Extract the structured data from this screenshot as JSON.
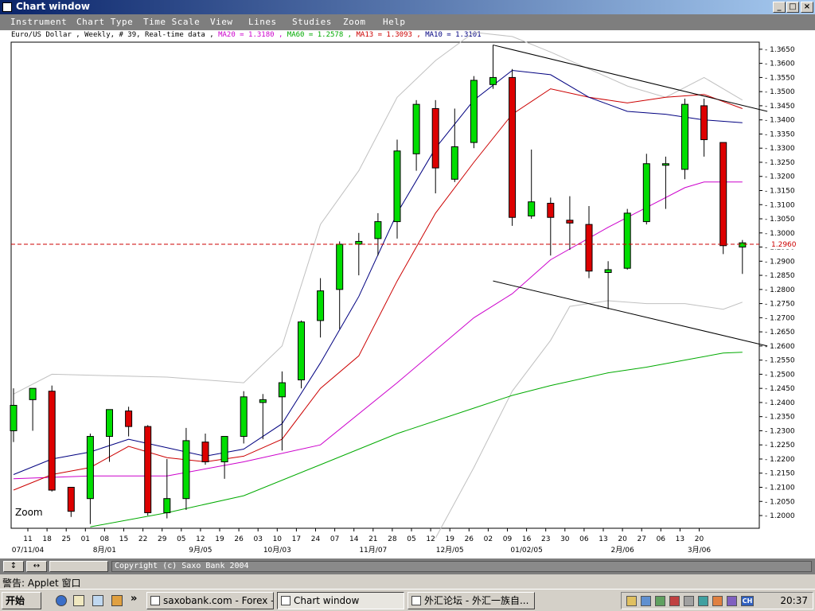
{
  "window": {
    "title": "Chart window",
    "min_label": "_",
    "max_label": "□",
    "close_label": "×"
  },
  "menu": [
    "Instrument",
    "Chart Type",
    "Time Scale",
    "View",
    "Lines",
    "Studies",
    "Zoom",
    "Help"
  ],
  "header": {
    "instrument": "Euro/US Dollar , Weekly, # 39, Real-time data ,",
    "ma20": "MA20 = 1.3180 ,",
    "ma60": "MA60 = 1.2578 ,",
    "ma13": "MA13 = 1.3093 ,",
    "ma10": "MA10 = 1.3101"
  },
  "chart_data": {
    "type": "candlestick",
    "zoom_label": "Zoom",
    "current_price": 1.296,
    "current_price_label": "1.2960",
    "yticks": [
      "1.2000",
      "1.2050",
      "1.2100",
      "1.2150",
      "1.2200",
      "1.2250",
      "1.2300",
      "1.2350",
      "1.2400",
      "1.2450",
      "1.2500",
      "1.2550",
      "1.2600",
      "1.2650",
      "1.2700",
      "1.2750",
      "1.2800",
      "1.2850",
      "1.2900",
      "1.2950",
      "1.3000",
      "1.3050",
      "1.3100",
      "1.3150",
      "1.3200",
      "1.3250",
      "1.3300",
      "1.3350",
      "1.3400",
      "1.3450",
      "1.3500",
      "1.3550",
      "1.3600",
      "1.3650"
    ],
    "xticks": [
      "11",
      "18",
      "25",
      "01",
      "08",
      "15",
      "22",
      "29",
      "05",
      "12",
      "19",
      "26",
      "03",
      "10",
      "17",
      "24",
      "07",
      "14",
      "21",
      "28",
      "05",
      "12",
      "19",
      "26",
      "02",
      "09",
      "16",
      "23",
      "30",
      "06",
      "13",
      "20",
      "27",
      "06",
      "13",
      "20"
    ],
    "month_labels": [
      {
        "label": "07/11/04",
        "week": 0
      },
      {
        "label": "8月/01",
        "week": 4
      },
      {
        "label": "9月/05",
        "week": 9
      },
      {
        "label": "10月/03",
        "week": 13
      },
      {
        "label": "11月/07",
        "week": 18
      },
      {
        "label": "12月/05",
        "week": 22
      },
      {
        "label": "01/02/05",
        "week": 26
      },
      {
        "label": "2月/06",
        "week": 31
      },
      {
        "label": "3月/06",
        "week": 35
      }
    ],
    "candles": [
      {
        "o": 1.23,
        "h": 1.245,
        "l": 1.226,
        "c": 1.239
      },
      {
        "o": 1.241,
        "h": 1.245,
        "l": 1.23,
        "c": 1.245
      },
      {
        "o": 1.244,
        "h": 1.246,
        "l": 1.2085,
        "c": 1.209
      },
      {
        "o": 1.21,
        "h": 1.21,
        "l": 1.1995,
        "c": 1.2015
      },
      {
        "o": 1.206,
        "h": 1.229,
        "l": 1.197,
        "c": 1.228
      },
      {
        "o": 1.228,
        "h": 1.2375,
        "l": 1.219,
        "c": 1.2375
      },
      {
        "o": 1.237,
        "h": 1.2385,
        "l": 1.228,
        "c": 1.2315
      },
      {
        "o": 1.2315,
        "h": 1.232,
        "l": 1.2,
        "c": 1.201
      },
      {
        "o": 1.201,
        "h": 1.22,
        "l": 1.199,
        "c": 1.206
      },
      {
        "o": 1.206,
        "h": 1.231,
        "l": 1.202,
        "c": 1.2265
      },
      {
        "o": 1.226,
        "h": 1.229,
        "l": 1.218,
        "c": 1.219
      },
      {
        "o": 1.219,
        "h": 1.228,
        "l": 1.213,
        "c": 1.228
      },
      {
        "o": 1.228,
        "h": 1.244,
        "l": 1.2255,
        "c": 1.242
      },
      {
        "o": 1.24,
        "h": 1.243,
        "l": 1.227,
        "c": 1.241
      },
      {
        "o": 1.242,
        "h": 1.251,
        "l": 1.223,
        "c": 1.247
      },
      {
        "o": 1.248,
        "h": 1.269,
        "l": 1.245,
        "c": 1.2685
      },
      {
        "o": 1.269,
        "h": 1.284,
        "l": 1.263,
        "c": 1.2795
      },
      {
        "o": 1.28,
        "h": 1.297,
        "l": 1.266,
        "c": 1.296
      },
      {
        "o": 1.296,
        "h": 1.3,
        "l": 1.285,
        "c": 1.297
      },
      {
        "o": 1.298,
        "h": 1.307,
        "l": 1.292,
        "c": 1.304
      },
      {
        "o": 1.304,
        "h": 1.333,
        "l": 1.298,
        "c": 1.329
      },
      {
        "o": 1.328,
        "h": 1.347,
        "l": 1.322,
        "c": 1.3455
      },
      {
        "o": 1.344,
        "h": 1.347,
        "l": 1.314,
        "c": 1.323
      },
      {
        "o": 1.319,
        "h": 1.344,
        "l": 1.318,
        "c": 1.3305
      },
      {
        "o": 1.332,
        "h": 1.3555,
        "l": 1.33,
        "c": 1.354
      },
      {
        "o": 1.3525,
        "h": 1.3665,
        "l": 1.351,
        "c": 1.355
      },
      {
        "o": 1.355,
        "h": 1.358,
        "l": 1.3025,
        "c": 1.3055
      },
      {
        "o": 1.306,
        "h": 1.3295,
        "l": 1.305,
        "c": 1.311
      },
      {
        "o": 1.3105,
        "h": 1.3125,
        "l": 1.292,
        "c": 1.3055
      },
      {
        "o": 1.3045,
        "h": 1.313,
        "l": 1.294,
        "c": 1.3035
      },
      {
        "o": 1.303,
        "h": 1.3095,
        "l": 1.284,
        "c": 1.2865
      },
      {
        "o": 1.286,
        "h": 1.29,
        "l": 1.273,
        "c": 1.287
      },
      {
        "o": 1.2875,
        "h": 1.3085,
        "l": 1.287,
        "c": 1.307
      },
      {
        "o": 1.304,
        "h": 1.328,
        "l": 1.303,
        "c": 1.3245
      },
      {
        "o": 1.3245,
        "h": 1.327,
        "l": 1.3085,
        "c": 1.3245
      },
      {
        "o": 1.3225,
        "h": 1.3475,
        "l": 1.319,
        "c": 1.3455
      },
      {
        "o": 1.345,
        "h": 1.3475,
        "l": 1.327,
        "c": 1.333
      },
      {
        "o": 1.332,
        "h": 1.332,
        "l": 1.2925,
        "c": 1.2955
      },
      {
        "o": 1.295,
        "h": 1.2975,
        "l": 1.2855,
        "c": 1.2965
      }
    ],
    "ma_series": [
      {
        "name": "MA20",
        "color": "#cc00cc",
        "values": [
          [
            0,
            1.213
          ],
          [
            4,
            1.214
          ],
          [
            8,
            1.214
          ],
          [
            12,
            1.219
          ],
          [
            16,
            1.225
          ],
          [
            20,
            1.247
          ],
          [
            24,
            1.27
          ],
          [
            26,
            1.2785
          ],
          [
            28,
            1.2905
          ],
          [
            31,
            1.302
          ],
          [
            33,
            1.309
          ],
          [
            35,
            1.316
          ],
          [
            36,
            1.318
          ],
          [
            38,
            1.318
          ]
        ]
      },
      {
        "name": "MA60",
        "color": "#00aa00",
        "values": [
          [
            4,
            1.196
          ],
          [
            8,
            1.201
          ],
          [
            12,
            1.207
          ],
          [
            16,
            1.218
          ],
          [
            20,
            1.229
          ],
          [
            24,
            1.238
          ],
          [
            26,
            1.2425
          ],
          [
            28,
            1.246
          ],
          [
            31,
            1.2505
          ],
          [
            33,
            1.2525
          ],
          [
            35,
            1.255
          ],
          [
            37,
            1.2575
          ],
          [
            38,
            1.2578
          ]
        ]
      },
      {
        "name": "MA13",
        "color": "#cc0000",
        "values": [
          [
            0,
            1.209
          ],
          [
            2,
            1.2145
          ],
          [
            4,
            1.217
          ],
          [
            6,
            1.2245
          ],
          [
            8,
            1.2205
          ],
          [
            10,
            1.219
          ],
          [
            12,
            1.221
          ],
          [
            14,
            1.227
          ],
          [
            16,
            1.245
          ],
          [
            18,
            1.2565
          ],
          [
            20,
            1.283
          ],
          [
            22,
            1.307
          ],
          [
            24,
            1.325
          ],
          [
            26,
            1.342
          ],
          [
            28,
            1.351
          ],
          [
            30,
            1.348
          ],
          [
            32,
            1.346
          ],
          [
            34,
            1.348
          ],
          [
            36,
            1.349
          ],
          [
            38,
            1.344
          ]
        ]
      },
      {
        "name": "MA10",
        "color": "#000080",
        "values": [
          [
            0,
            1.2145
          ],
          [
            2,
            1.22
          ],
          [
            4,
            1.2225
          ],
          [
            6,
            1.227
          ],
          [
            8,
            1.224
          ],
          [
            10,
            1.221
          ],
          [
            12,
            1.2235
          ],
          [
            14,
            1.2325
          ],
          [
            16,
            1.254
          ],
          [
            18,
            1.2775
          ],
          [
            20,
            1.307
          ],
          [
            22,
            1.33
          ],
          [
            24,
            1.347
          ],
          [
            26,
            1.3575
          ],
          [
            28,
            1.356
          ],
          [
            30,
            1.348
          ],
          [
            32,
            1.343
          ],
          [
            34,
            1.342
          ],
          [
            36,
            1.34
          ],
          [
            38,
            1.339
          ]
        ]
      }
    ],
    "bollinger_upper": [
      [
        0,
        1.243
      ],
      [
        2,
        1.25
      ],
      [
        8,
        1.249
      ],
      [
        12,
        1.247
      ],
      [
        14,
        1.26
      ],
      [
        16,
        1.303
      ],
      [
        18,
        1.322
      ],
      [
        20,
        1.348
      ],
      [
        22,
        1.361
      ],
      [
        24,
        1.371
      ],
      [
        26,
        1.3695
      ],
      [
        28,
        1.364
      ],
      [
        30,
        1.358
      ],
      [
        32,
        1.352
      ],
      [
        34,
        1.348
      ],
      [
        36,
        1.355
      ],
      [
        38,
        1.347
      ]
    ],
    "bollinger_lower": [
      [
        22,
        1.192
      ],
      [
        24,
        1.217
      ],
      [
        26,
        1.244
      ],
      [
        28,
        1.262
      ],
      [
        29,
        1.274
      ],
      [
        31,
        1.276
      ],
      [
        33,
        1.275
      ],
      [
        35,
        1.275
      ],
      [
        37,
        1.273
      ],
      [
        38,
        1.2755
      ]
    ],
    "trendlines": [
      {
        "from": [
          25,
          1.3665
        ],
        "to": [
          39.3,
          1.343
        ]
      },
      {
        "from": [
          25,
          1.283
        ],
        "to": [
          39.3,
          1.26
        ]
      }
    ]
  },
  "status": {
    "copyright": "Copyright (c) Saxo Bank 2004",
    "btn1": "↕",
    "btn2": "↔"
  },
  "applet_text": "警告: Applet 窗口",
  "taskbar": {
    "start_label": "开始",
    "tasks": [
      "saxobank.com - Forex - ...",
      "Chart window",
      "外汇论坛 - 外汇一族自..."
    ],
    "tray_lang": "CH",
    "clock": "20:37",
    "overflow": "»"
  }
}
